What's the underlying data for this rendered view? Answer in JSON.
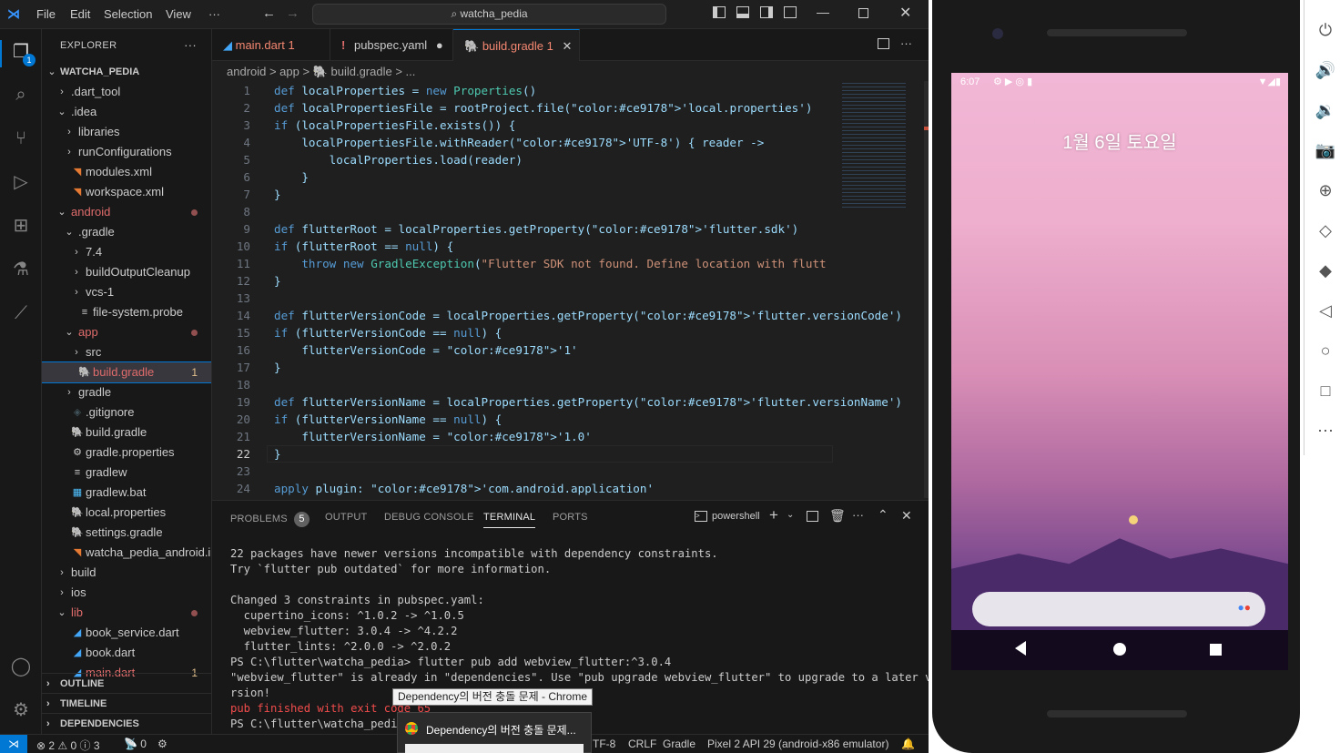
{
  "menu": [
    "File",
    "Edit",
    "Selection",
    "View",
    "···"
  ],
  "search": "watcha_pedia",
  "explorer": {
    "header": "EXPLORER",
    "root": "WATCHA_PEDIA",
    "items": [
      {
        "label": ".dart_tool",
        "depth": 1,
        "chev": "›"
      },
      {
        "label": ".idea",
        "depth": 1,
        "chev": "⌄"
      },
      {
        "label": "libraries",
        "depth": 2,
        "chev": "›"
      },
      {
        "label": "runConfigurations",
        "depth": 2,
        "chev": "›"
      },
      {
        "label": "modules.xml",
        "depth": 2,
        "icon": "xml"
      },
      {
        "label": "workspace.xml",
        "depth": 2,
        "icon": "xml"
      },
      {
        "label": "android",
        "depth": 1,
        "chev": "⌄",
        "color": "#e06c6c",
        "dot": true
      },
      {
        "label": ".gradle",
        "depth": 2,
        "chev": "⌄"
      },
      {
        "label": "7.4",
        "depth": 3,
        "chev": "›"
      },
      {
        "label": "buildOutputCleanup",
        "depth": 3,
        "chev": "›"
      },
      {
        "label": "vcs-1",
        "depth": 3,
        "chev": "›"
      },
      {
        "label": "file-system.probe",
        "depth": 3,
        "icon": "lines"
      },
      {
        "label": "app",
        "depth": 2,
        "chev": "⌄",
        "color": "#e06c6c",
        "dot": true
      },
      {
        "label": "src",
        "depth": 3,
        "chev": "›"
      },
      {
        "label": "build.gradle",
        "depth": 3,
        "icon": "gradle",
        "color": "#e06c6c",
        "count": "1",
        "selected": true
      },
      {
        "label": "gradle",
        "depth": 2,
        "chev": "›"
      },
      {
        "label": ".gitignore",
        "depth": 2,
        "icon": "git"
      },
      {
        "label": "build.gradle",
        "depth": 2,
        "icon": "gradle"
      },
      {
        "label": "gradle.properties",
        "depth": 2,
        "icon": "gear"
      },
      {
        "label": "gradlew",
        "depth": 2,
        "icon": "lines"
      },
      {
        "label": "gradlew.bat",
        "depth": 2,
        "icon": "win"
      },
      {
        "label": "local.properties",
        "depth": 2,
        "icon": "gradle"
      },
      {
        "label": "settings.gradle",
        "depth": 2,
        "icon": "gradle"
      },
      {
        "label": "watcha_pedia_android.i...",
        "depth": 2,
        "icon": "xml"
      },
      {
        "label": "build",
        "depth": 1,
        "chev": "›"
      },
      {
        "label": "ios",
        "depth": 1,
        "chev": "›"
      },
      {
        "label": "lib",
        "depth": 1,
        "chev": "⌄",
        "color": "#e06c6c",
        "dot": true
      },
      {
        "label": "book_service.dart",
        "depth": 2,
        "icon": "dart"
      },
      {
        "label": "book.dart",
        "depth": 2,
        "icon": "dart"
      },
      {
        "label": "main.dart",
        "depth": 2,
        "icon": "dart",
        "color": "#e06c6c",
        "count": "1"
      }
    ],
    "sections": [
      "OUTLINE",
      "TIMELINE",
      "DEPENDENCIES"
    ]
  },
  "tabs": [
    {
      "label": "main.dart",
      "suffix": "1",
      "color": "#f48771"
    },
    {
      "label": "pubspec.yaml",
      "suffix": "●",
      "color": "#ccc",
      "prefix": "!"
    },
    {
      "label": "build.gradle",
      "suffix": "1",
      "color": "#f48771",
      "active": true
    }
  ],
  "breadcrumb": "android > app > 🐘 build.gradle > ...",
  "code": [
    "def localProperties = new Properties()",
    "def localPropertiesFile = rootProject.file('local.properties')",
    "if (localPropertiesFile.exists()) {",
    "    localPropertiesFile.withReader('UTF-8') { reader ->",
    "        localProperties.load(reader)",
    "    }",
    "}",
    "",
    "def flutterRoot = localProperties.getProperty('flutter.sdk')",
    "if (flutterRoot == null) {",
    "    throw new GradleException(\"Flutter SDK not found. Define location with flutt",
    "}",
    "",
    "def flutterVersionCode = localProperties.getProperty('flutter.versionCode')",
    "if (flutterVersionCode == null) {",
    "    flutterVersionCode = '1'",
    "}",
    "",
    "def flutterVersionName = localProperties.getProperty('flutter.versionName')",
    "if (flutterVersionName == null) {",
    "    flutterVersionName = '1.0'",
    "}",
    "",
    "apply plugin: 'com.android.application'"
  ],
  "panel": {
    "tabs": [
      {
        "label": "PROBLEMS",
        "badge": "5"
      },
      {
        "label": "OUTPUT"
      },
      {
        "label": "DEBUG CONSOLE"
      },
      {
        "label": "TERMINAL",
        "active": true
      },
      {
        "label": "PORTS"
      }
    ],
    "shell": "powershell",
    "terminal": [
      {
        "t": "22 packages have newer versions incompatible with dependency constraints."
      },
      {
        "t": "Try `flutter pub outdated` for more information."
      },
      {
        "t": ""
      },
      {
        "t": "Changed 3 constraints in pubspec.yaml:"
      },
      {
        "t": "  cupertino_icons: ^1.0.2 -> ^1.0.5"
      },
      {
        "t": "  webview_flutter: 3.0.4 -> ^4.2.2"
      },
      {
        "t": "  flutter_lints: ^2.0.0 -> ^2.0.2"
      },
      {
        "t": "PS C:\\flutter\\watcha_pedia> flutter pub add webview_flutter:^3.0.4"
      },
      {
        "t": "\"webview_flutter\" is already in \"dependencies\". Use \"pub upgrade webview_flutter\" to upgrade to a later ve"
      },
      {
        "t": "rsion!"
      },
      {
        "t": "pub finished with exit code 65",
        "color": "#f14c4c"
      },
      {
        "t": "PS C:\\flutter\\watcha_pedia"
      }
    ]
  },
  "status": {
    "errors": "⊗ 2 ⚠ 0 ⓘ 3",
    "ports": "📡 0",
    "encoding": "TF-8",
    "eol": "CRLF",
    "lang": "Gradle",
    "device": "Pixel 2 API 29 (android-x86 emulator)"
  },
  "tooltip": "Dependency의 버전 충돌 문제 - Chrome",
  "taskbar_thumb": "Dependency의 버전 충돌 문제...",
  "phone": {
    "time": "6:07",
    "date": "1월 6일 토요일"
  }
}
